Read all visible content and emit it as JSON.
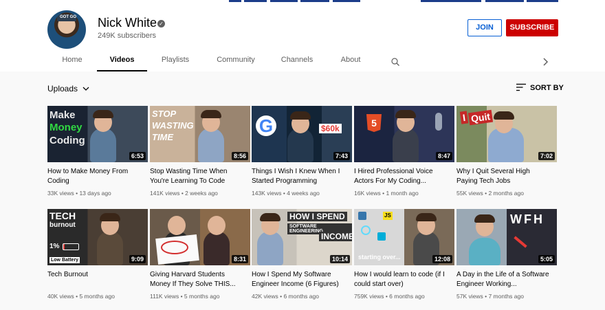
{
  "channel": {
    "name": "Nick White",
    "subscribers": "249K subscribers",
    "avatar_hat_text": "GOT GO",
    "join_label": "JOIN",
    "subscribe_label": "SUBSCRIBE"
  },
  "tabs": [
    {
      "label": "Home"
    },
    {
      "label": "Videos"
    },
    {
      "label": "Playlists"
    },
    {
      "label": "Community"
    },
    {
      "label": "Channels"
    },
    {
      "label": "About"
    }
  ],
  "active_tab": "Videos",
  "toolbar": {
    "uploads_label": "Uploads",
    "sort_label": "SORT BY"
  },
  "videos": [
    {
      "title": "How to Make Money From Coding",
      "views": "33K views",
      "age": "13 days ago",
      "duration": "6:53",
      "overlay": [
        "Make",
        "Money",
        "Coding"
      ]
    },
    {
      "title": "Stop Wasting Time When You're Learning To Code",
      "views": "141K views",
      "age": "2 weeks ago",
      "duration": "8:56",
      "overlay": [
        "STOP",
        "WASTING",
        "TIME"
      ]
    },
    {
      "title": "Things I Wish I Knew When I Started Programming",
      "views": "143K views",
      "age": "4 weeks ago",
      "duration": "7:43",
      "overlay": [
        "G",
        "$60k"
      ]
    },
    {
      "title": "I Hired Professional Voice Actors For My Coding...",
      "views": "16K views",
      "age": "1 month ago",
      "duration": "8:47",
      "overlay": [
        "5"
      ]
    },
    {
      "title": "Why I Quit Several High Paying Tech Jobs",
      "views": "55K views",
      "age": "2 months ago",
      "duration": "7:02",
      "overlay": [
        "I",
        "Quit"
      ]
    },
    {
      "title": "Tech Burnout",
      "views": "40K views",
      "age": "5 months ago",
      "duration": "9:09",
      "overlay": [
        "TECH",
        "burnout",
        "1%",
        "Low Battery"
      ]
    },
    {
      "title": "Giving Harvard Students Money If They Solve THIS...",
      "views": "111K views",
      "age": "5 months ago",
      "duration": "8:31",
      "overlay": []
    },
    {
      "title": "How I Spend My Software Engineer Income (6 Figures)",
      "views": "42K views",
      "age": "6 months ago",
      "duration": "10:14",
      "overlay": [
        "HOW I SPEND",
        "SOFTWARE ENGINEERING",
        "INCOME"
      ]
    },
    {
      "title": "How I would learn to code (if I could start over)",
      "views": "759K views",
      "age": "6 months ago",
      "duration": "12:08",
      "overlay": [
        "JS",
        "starting over..."
      ]
    },
    {
      "title": "A Day in the Life of a Software Engineer Working...",
      "views": "57K views",
      "age": "7 months ago",
      "duration": "5:05",
      "overlay": [
        "WFH"
      ]
    }
  ],
  "colors": {
    "subscribe": "#cc0000",
    "join": "#065fd4",
    "meta_text": "#606060"
  },
  "icons": [
    "verified-icon",
    "search-icon",
    "chevron-right-icon",
    "chevron-down-icon",
    "sort-icon"
  ]
}
